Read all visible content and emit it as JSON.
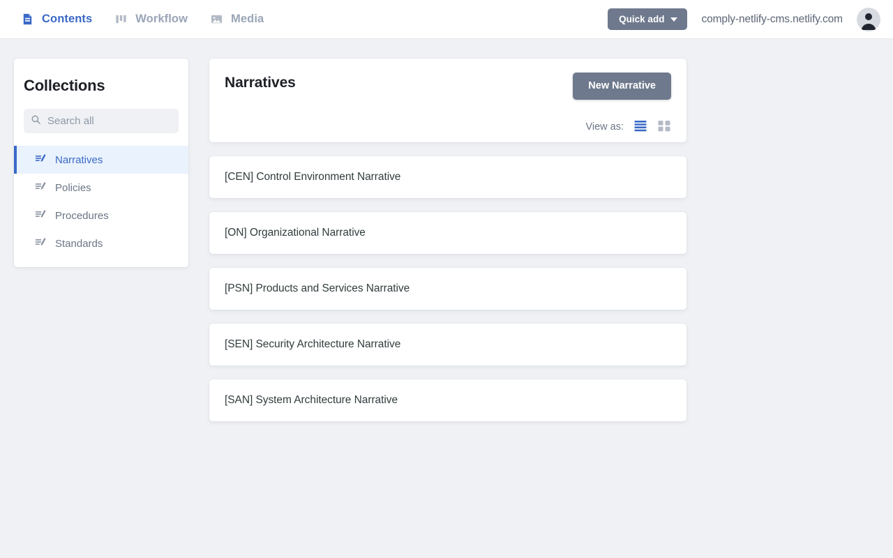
{
  "header": {
    "nav": [
      {
        "label": "Contents",
        "icon": "document-icon",
        "active": true
      },
      {
        "label": "Workflow",
        "icon": "kanban-columns-icon",
        "active": false
      },
      {
        "label": "Media",
        "icon": "image-icon",
        "active": false
      }
    ],
    "quick_add_label": "Quick add",
    "quick_add_icon": "chevron-down-icon",
    "site_url": "comply-netlify-cms.netlify.com",
    "avatar_icon": "user-avatar-icon"
  },
  "sidebar": {
    "title": "Collections",
    "search": {
      "placeholder": "Search all",
      "value": "",
      "icon": "search-icon"
    },
    "items": [
      {
        "label": "Narratives",
        "icon": "write-lines-icon",
        "active": true
      },
      {
        "label": "Policies",
        "icon": "write-lines-icon",
        "active": false
      },
      {
        "label": "Procedures",
        "icon": "write-lines-icon",
        "active": false
      },
      {
        "label": "Standards",
        "icon": "write-lines-icon",
        "active": false
      }
    ]
  },
  "main": {
    "panel_title": "Narratives",
    "new_button_label": "New Narrative",
    "view_as_label": "View as:",
    "view_modes": [
      {
        "name": "list-view",
        "icon": "list-view-icon",
        "active": true
      },
      {
        "name": "grid-view",
        "icon": "grid-view-icon",
        "active": false
      }
    ],
    "entries": [
      {
        "title": "[CEN] Control Environment Narrative"
      },
      {
        "title": "[ON] Organizational Narrative"
      },
      {
        "title": "[PSN] Products and Services Narrative"
      },
      {
        "title": "[SEN] Security Architecture Narrative"
      },
      {
        "title": "[SAN] System Architecture Narrative"
      }
    ]
  },
  "colors": {
    "accent_blue": "#3a69c7",
    "button_gray": "#6f798d",
    "page_bg": "#eff1f4",
    "active_item_bg": "#e9f2fd",
    "muted_text": "#6b7585"
  }
}
